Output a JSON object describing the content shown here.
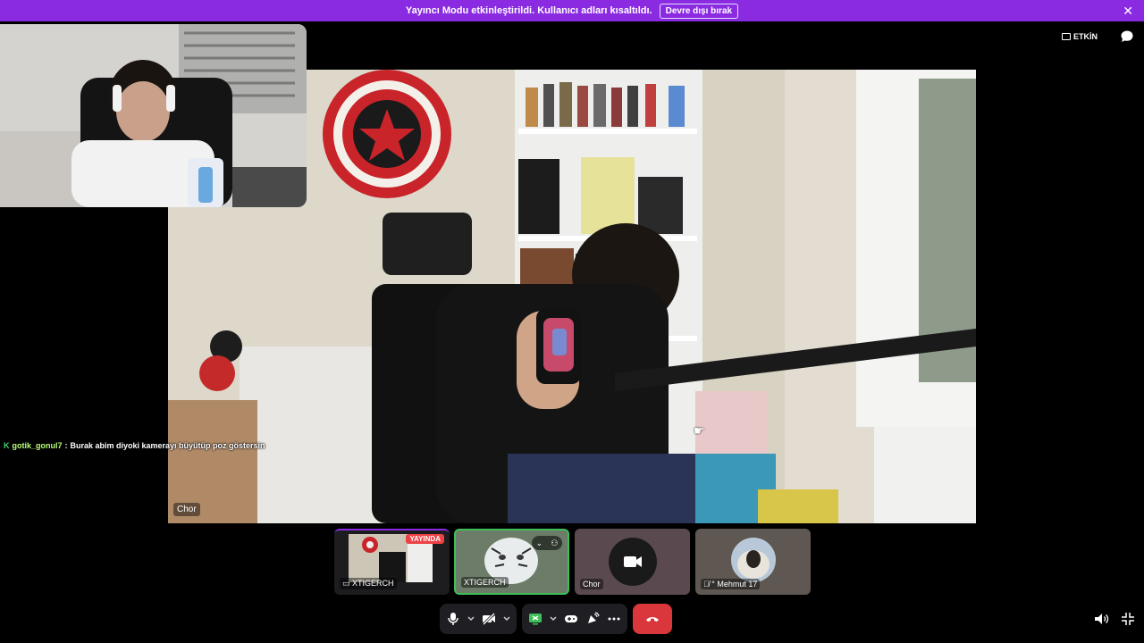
{
  "banner": {
    "message": "Yayıncı Modu etkinleştirildi. Kullanıcı adları kısaltıldı.",
    "disable_label": "Devre dışı bırak"
  },
  "top_right": {
    "activity_label": "ETKİN",
    "icons": [
      "activity-icon",
      "chat-bubble-icon"
    ]
  },
  "main_stage": {
    "label": "Chor"
  },
  "chat_overlay": {
    "badge": "K",
    "username": "gotik_gonul7",
    "separator": ":",
    "message": "Burak abim diyoki kamerayı büyütüp poz göstersin"
  },
  "participants": [
    {
      "name": "XTIGERCH",
      "status": "YAYINDA",
      "streaming": true
    },
    {
      "name": "XTIGERCH",
      "speaking": true
    },
    {
      "name": "Chor"
    },
    {
      "name": "° Mehmut 17",
      "muted": true
    }
  ],
  "controls": {
    "icons": [
      "microphone-icon",
      "camera-off-icon",
      "screen-share-icon",
      "gamepad-icon",
      "soundboard-icon",
      "more-icon",
      "hang-up-icon"
    ]
  },
  "bottom_right": {
    "icons": [
      "volume-icon",
      "exit-fullscreen-icon"
    ]
  },
  "colors": {
    "banner": "#8a2be2",
    "live": "#ed4245",
    "speaking": "#3fbf5a",
    "hangup": "#da373c"
  }
}
